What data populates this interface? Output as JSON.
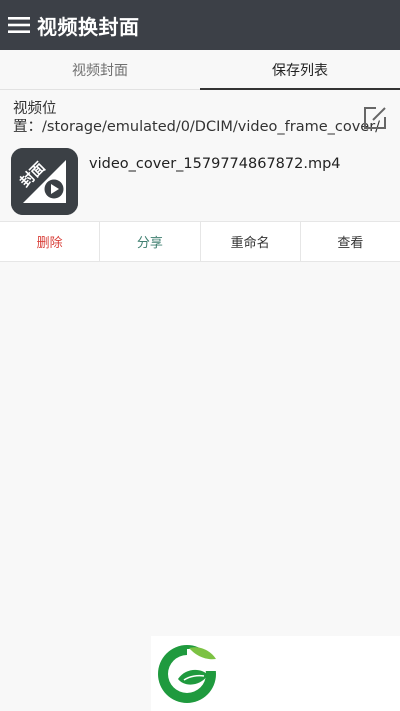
{
  "header": {
    "title": "视频换封面",
    "background": "#3c4047"
  },
  "tabs": [
    {
      "label": "视频封面",
      "active": false
    },
    {
      "label": "保存列表",
      "active": true
    }
  ],
  "path": {
    "label": "视频位置：",
    "value": "/storage/emulated/0/DCIM/video_frame_cover/"
  },
  "file": {
    "name": "video_cover_1579774867872.mp4",
    "thumb_text": "封面",
    "thumb_icon": "play-circle-icon"
  },
  "actions": [
    {
      "label": "删除",
      "color": "#d9403a"
    },
    {
      "label": "分享",
      "color": "#3f7f70"
    },
    {
      "label": "重命名",
      "color": "#333333"
    },
    {
      "label": "查看",
      "color": "#333333"
    }
  ],
  "logo": {
    "icon": "leaf-g-logo-icon",
    "colors": {
      "primary": "#1f9a3e",
      "light": "#7cc243"
    }
  }
}
